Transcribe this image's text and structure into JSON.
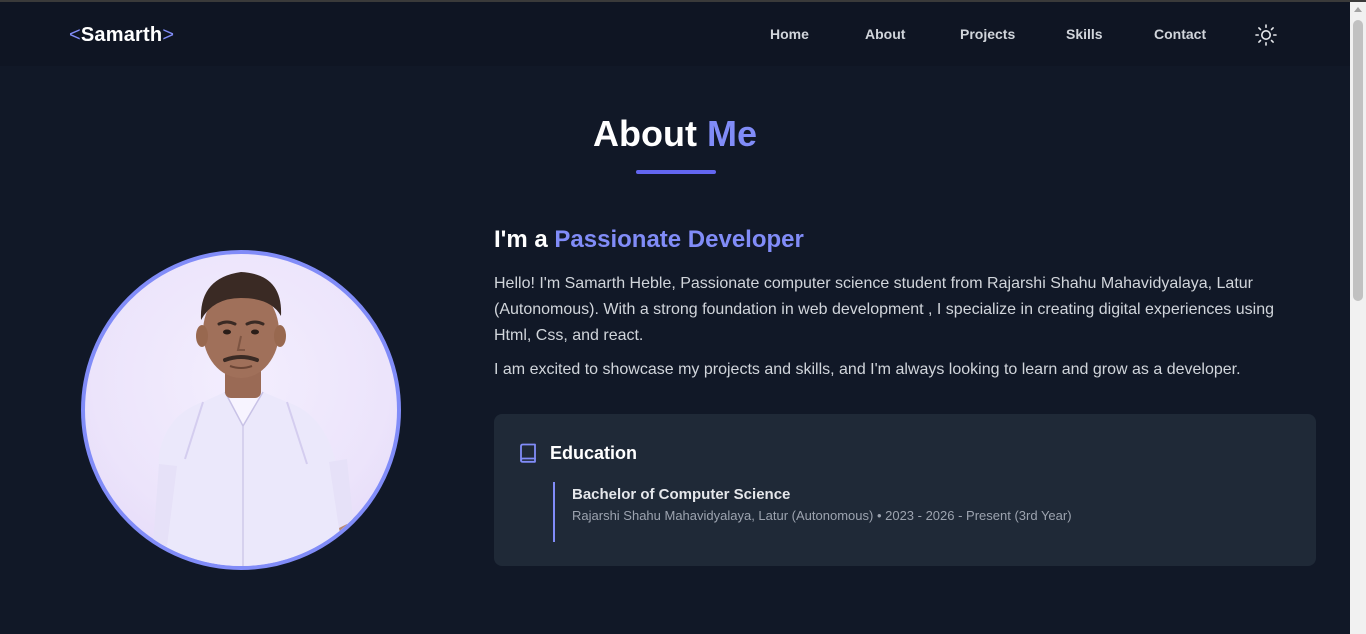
{
  "nav": {
    "logo_open": "<",
    "logo_name": "Samarth",
    "logo_close": ">",
    "links": [
      "Home",
      "About",
      "Projects",
      "Skills",
      "Contact"
    ],
    "theme_icon": "sun-icon"
  },
  "about": {
    "title_main": "About",
    "title_accent": "Me",
    "heading_prefix": "I'm a",
    "heading_accent": "Passionate Developer",
    "paragraph1": "Hello! I'm Samarth Heble, Passionate computer science student from Rajarshi Shahu Mahavidyalaya, Latur (Autonomous). With a strong foundation in web development , I specialize in creating digital experiences using Html, Css, and react.",
    "paragraph2": "I am excited to showcase my projects and skills, and I'm always looking to learn and grow as a developer.",
    "education": {
      "title": "Education",
      "icon": "book-icon",
      "degree": "Bachelor of Computer Science",
      "detail": "Rajarshi Shahu Mahavidyalaya, Latur (Autonomous) • 2023 - 2026 - Present (3rd Year)"
    }
  },
  "colors": {
    "background": "#111827",
    "navbar": "#0f1523",
    "accent": "#818cf8",
    "underline": "#6366f1",
    "card": "#1f2937"
  }
}
